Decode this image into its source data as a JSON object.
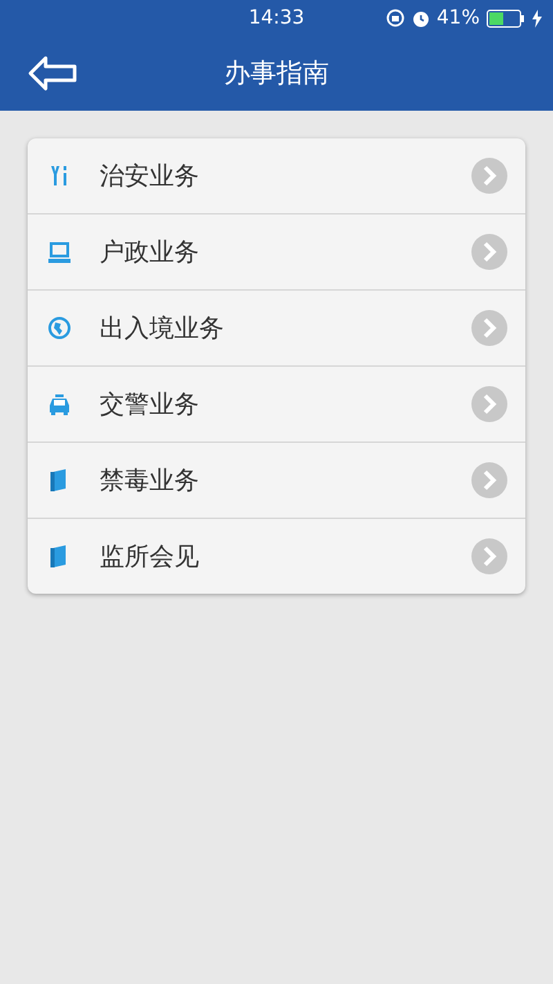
{
  "status_bar": {
    "time": "14:33",
    "battery": "41%"
  },
  "header": {
    "title": "办事指南"
  },
  "menu": [
    {
      "label": "治安业务",
      "kind": "tools"
    },
    {
      "label": "户政业务",
      "kind": "computer"
    },
    {
      "label": "出入境业务",
      "kind": "globe"
    },
    {
      "label": "交警业务",
      "kind": "car"
    },
    {
      "label": "禁毒业务",
      "kind": "book"
    },
    {
      "label": "监所会见",
      "kind": "book"
    }
  ]
}
